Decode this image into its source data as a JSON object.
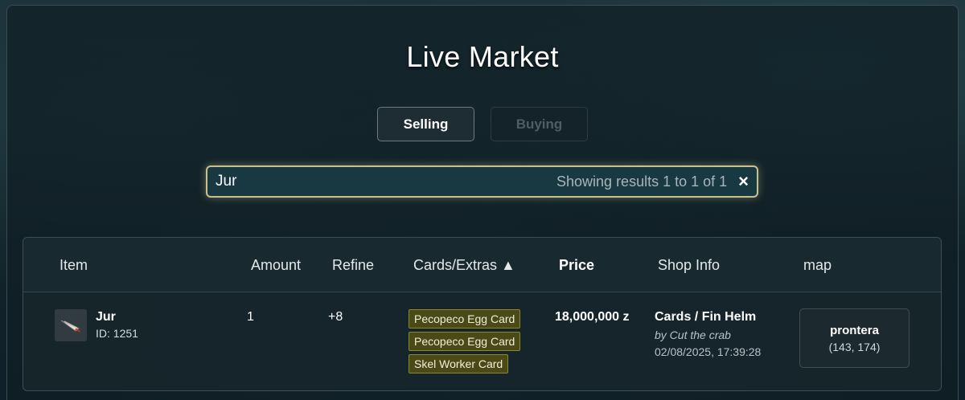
{
  "page": {
    "title": "Live Market"
  },
  "tabs": [
    {
      "label": "Selling",
      "active": true
    },
    {
      "label": "Buying",
      "active": false
    }
  ],
  "search": {
    "value": "Jur",
    "results_text": "Showing results 1 to 1 of 1",
    "clear_icon": "×"
  },
  "table": {
    "columns": {
      "item": "Item",
      "amount": "Amount",
      "refine": "Refine",
      "cards": "Cards/Extras ▲",
      "price": "Price",
      "shop_info": "Shop Info",
      "map": "map"
    },
    "rows": [
      {
        "icon": "sword-item-icon",
        "name": "Jur",
        "id": "ID: 1251",
        "amount": "1",
        "refine": "+8",
        "cards": [
          "Pecopeco Egg Card",
          "Pecopeco Egg Card",
          "Skel Worker Card"
        ],
        "price": "18,000,000 z",
        "shop_name": "Cards / Fin Helm",
        "shop_by": "by Cut the crab",
        "shop_time": "02/08/2025, 17:39:28",
        "map_name": "prontera",
        "map_coords": "(143, 174)"
      }
    ]
  },
  "colors": {
    "accent_border": "#c9c08e",
    "card_bg": "#4a4a16",
    "card_border": "#8e8630"
  }
}
